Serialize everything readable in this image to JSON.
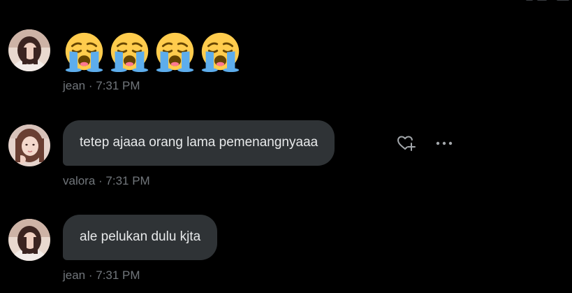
{
  "messages": [
    {
      "sender": "jean",
      "emoji_count": 4,
      "emoji": "loudly-crying-face",
      "time": "7:31 PM",
      "meta": "jean · 7:31 PM"
    },
    {
      "sender": "valora",
      "text": "tetep ajaaa orang lama pemenangnyaaa",
      "time": "7:31 PM",
      "meta": "valora · 7:31 PM",
      "actions": [
        {
          "icon": "heart-plus-icon"
        },
        {
          "icon": "more-icon"
        }
      ]
    },
    {
      "sender": "jean",
      "text": "ale pelukan dulu kjta",
      "time": "7:31 PM",
      "meta": "jean · 7:31 PM"
    }
  ],
  "colors": {
    "background": "#000000",
    "bubble": "#2f3336",
    "text": "#e7e9ea",
    "meta": "#71767b",
    "icon": "#a3a7ab"
  }
}
